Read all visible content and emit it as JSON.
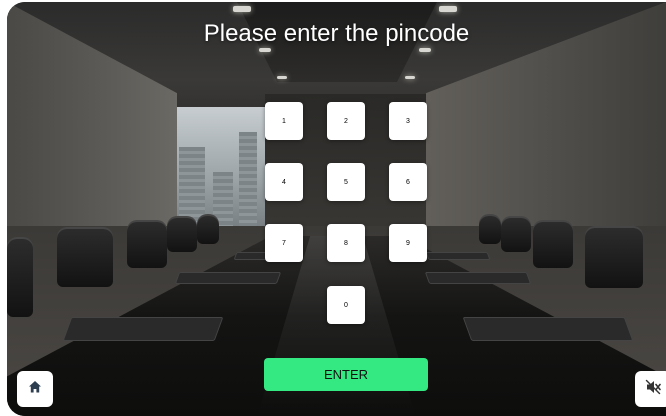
{
  "prompt": {
    "title": "Please enter the pincode"
  },
  "keypad": {
    "keys": [
      {
        "label": "1"
      },
      {
        "label": "2"
      },
      {
        "label": "3"
      },
      {
        "label": "4"
      },
      {
        "label": "5"
      },
      {
        "label": "6"
      },
      {
        "label": "7"
      },
      {
        "label": "8"
      },
      {
        "label": "9"
      },
      {
        "label": "0"
      }
    ]
  },
  "actions": {
    "enter_label": "ENTER"
  },
  "icons": {
    "home": "home-icon",
    "mute": "speaker-muted-icon"
  },
  "colors": {
    "enter_button": "#34e882",
    "key_background": "#ffffff",
    "title_text": "#ffffff"
  }
}
